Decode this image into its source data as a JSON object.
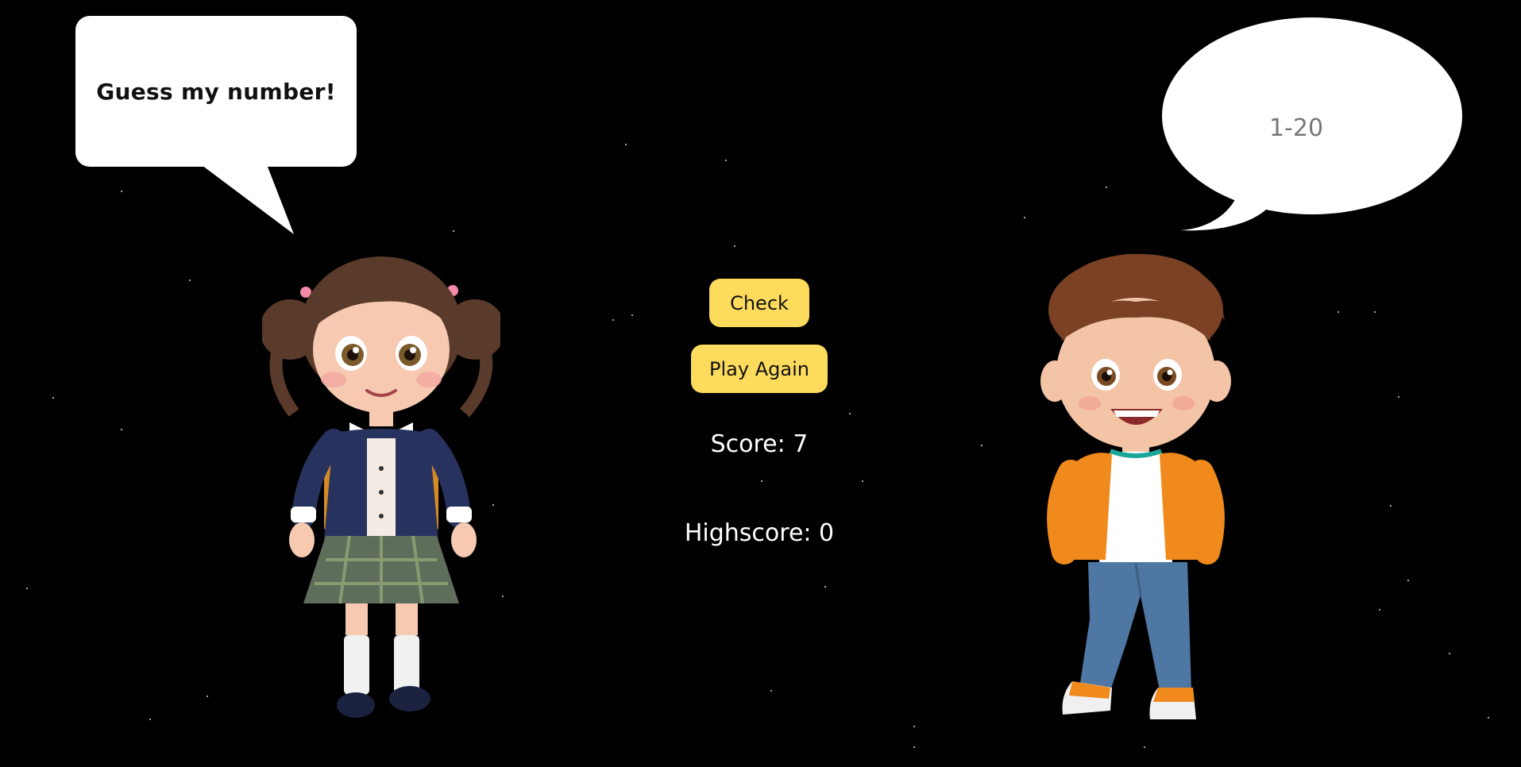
{
  "girl_bubble": {
    "text": "Guess my number!"
  },
  "boy_bubble": {
    "placeholder": "1-20",
    "value": ""
  },
  "buttons": {
    "check_label": "Check",
    "play_again_label": "Play Again"
  },
  "stats": {
    "score_text": "Score: 7",
    "highscore_text": "Highscore: 0"
  },
  "colors": {
    "background": "#000000",
    "button": "#fddb5c",
    "bubble": "#ffffff"
  },
  "characters": {
    "left": "girl-character",
    "right": "boy-character"
  }
}
